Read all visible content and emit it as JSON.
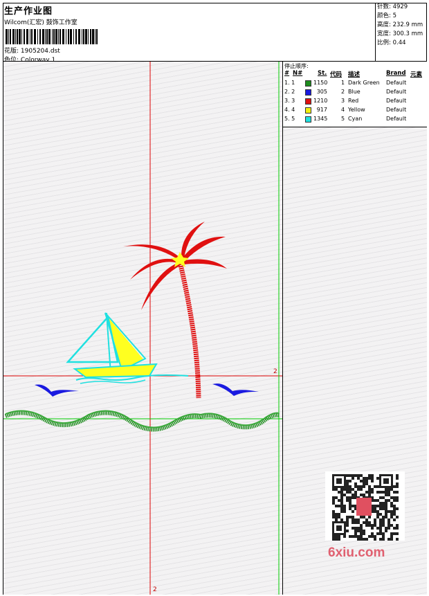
{
  "header": {
    "title": "生产作业图",
    "company": "Wilcom(汇宏) 鼓饰工作室",
    "design_label": "花版:",
    "design_value": "1905204.dst",
    "colorway_label": "色位:",
    "colorway_value": "Colorway 1"
  },
  "stats": [
    {
      "label": "针数:",
      "value": "4929"
    },
    {
      "label": "颜色:",
      "value": "5"
    },
    {
      "label": "高度:",
      "value": "232.9 mm"
    },
    {
      "label": "宽度:",
      "value": "300.3 mm"
    },
    {
      "label": "比例:",
      "value": "0.44"
    }
  ],
  "stop_sequence": {
    "title": "停止顺序:",
    "columns": [
      "#",
      "N#",
      "St.",
      "代码",
      "描述",
      "Brand",
      "元素"
    ],
    "rows": [
      {
        "idx": "1. 1",
        "color": "#1e8c1e",
        "st": "1150",
        "code": "1",
        "desc": "Dark Green",
        "brand": "Default"
      },
      {
        "idx": "2. 2",
        "color": "#1a1ae0",
        "st": "305",
        "code": "2",
        "desc": "Blue",
        "brand": "Default"
      },
      {
        "idx": "3. 3",
        "color": "#e01010",
        "st": "1210",
        "code": "3",
        "desc": "Red",
        "brand": "Default"
      },
      {
        "idx": "4. 4",
        "color": "#f0f010",
        "st": "917",
        "code": "4",
        "desc": "Yellow",
        "brand": "Default"
      },
      {
        "idx": "5. 5",
        "color": "#20e0e0",
        "st": "1345",
        "code": "5",
        "desc": "Cyan",
        "brand": "Default"
      }
    ]
  },
  "grid": {
    "h_label": "2",
    "v_label": "2"
  },
  "watermark": {
    "text": "6xiu.com"
  }
}
